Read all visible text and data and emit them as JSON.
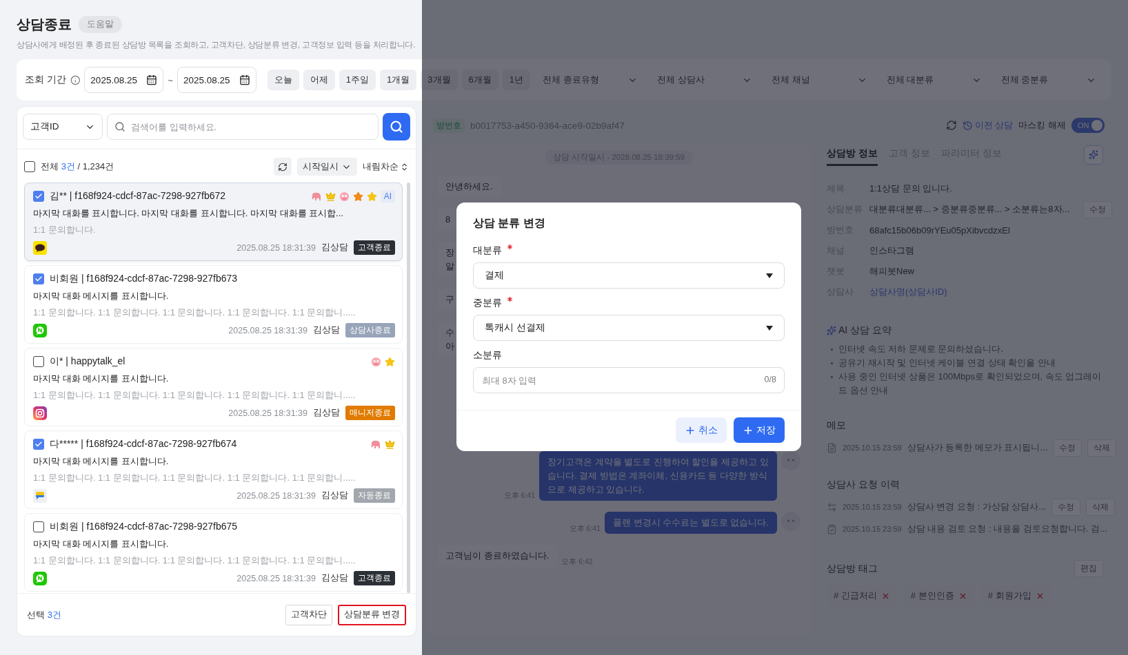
{
  "page": {
    "title": "상담종료",
    "help": "도움말",
    "description": "상담사에게 배정된 후 종료된 상담방 목록을 조회하고, 고객차단, 상담분류 변경, 고객정보 입력 등을 처리합니다."
  },
  "filters": {
    "period_label": "조회 기간",
    "date_from": "2025.08.25",
    "separator": "~",
    "date_to": "2025.08.25",
    "quick_ranges": [
      "오늘",
      "어제",
      "1주일",
      "1개월",
      "3개월",
      "6개월",
      "1년"
    ],
    "dropdowns": [
      "전체 종료유형",
      "전체 상담사",
      "전체 채널",
      "전체 대분류",
      "전체 중분류"
    ]
  },
  "search": {
    "type": "고객ID",
    "placeholder": "검색어를 입력하세요."
  },
  "list_header": {
    "select_all_checked": false,
    "total_label": "전체",
    "shown_count": "3건",
    "total_count": "/ 1,234건",
    "sort_field": "시작일시",
    "sort_order": "내림차순"
  },
  "items": [
    {
      "checked": true,
      "selected": true,
      "title": "김** | f168f924-cdcf-87ac-7298-927fb672",
      "ai": "AI",
      "message": "마지막 대화를 표시합니다.  마지막 대화를 표시합니다. 마지막 대화를 표시합...",
      "summary": "1:1 문의합니다.",
      "time": "2025.08.25 18:31:39",
      "agent": "김상담",
      "status": "고객종료",
      "color": "#2b2f36"
    },
    {
      "checked": true,
      "selected": false,
      "title": "비회원 | f168f924-cdcf-87ac-7298-927fb673",
      "message": "마지막 대화 메시지를 표시합니다.",
      "summary": "1:1 문의합니다. 1:1 문의합니다. 1:1 문의합니다. 1:1 문의합니다. 1:1 문의합니.....",
      "time": "2025.08.25 18:31:39",
      "agent": "김상담",
      "status": "상담사종료",
      "color": "#98a4b8"
    },
    {
      "checked": false,
      "selected": false,
      "title": "이* | happytalk_el",
      "message": "마지막 대화 메시지를 표시합니다.",
      "summary": "1:1 문의합니다. 1:1 문의합니다. 1:1 문의합니다. 1:1 문의합니다. 1:1 문의합니.....",
      "time": "2025.08.25 18:31:39",
      "agent": "김상담",
      "status": "매니저종료",
      "color": "#e07b00"
    },
    {
      "checked": true,
      "selected": false,
      "title": "다***** | f168f924-cdcf-87ac-7298-927fb674",
      "message": "마지막 대화 메시지를 표시합니다.",
      "summary": "1:1 문의합니다. 1:1 문의합니다. 1:1 문의합니다. 1:1 문의합니다. 1:1 문의합니.....",
      "time": "2025.08.25 18:31:39",
      "agent": "김상담",
      "status": "자동종료",
      "color": "#a2a6ad"
    },
    {
      "checked": false,
      "selected": false,
      "title": "비회원 | f168f924-cdcf-87ac-7298-927fb675",
      "message": "마지막 대화 메시지를 표시합니다.",
      "summary": "1:1 문의합니다. 1:1 문의합니다. 1:1 문의합니다. 1:1 문의합니다. 1:1 문의합니.....",
      "time": "2025.08.25 18:31:39",
      "agent": "김상담",
      "status": "고객종료",
      "color": "#2b2f36"
    }
  ],
  "footer": {
    "selected_label": "선택",
    "selected_count": "3건",
    "buttons": [
      {
        "label": "고객차단",
        "highlighted": false
      },
      {
        "label": "상담분류 변경",
        "highlighted": true
      }
    ]
  },
  "room": {
    "id_label": "방번호",
    "id": "b0017753-a450-9364-ace9-02b9af47",
    "history": "이전 상담",
    "masking_label": "마스킹 해제",
    "masking_on": true,
    "masking_text": "ON"
  },
  "chat": {
    "started": "상담 시작일시 - 2028.08.25 18:39:59",
    "messages": [
      {
        "kind": "customer",
        "lines": [
          "안녕하세요."
        ]
      },
      {
        "kind": "customer",
        "lines": [
          "8"
        ]
      },
      {
        "kind": "customer",
        "lines": [
          "장",
          "알"
        ]
      },
      {
        "kind": "customer",
        "lines": [
          "구"
        ]
      },
      {
        "kind": "customer",
        "lines": [
          "수",
          "아"
        ]
      },
      {
        "kind": "agent",
        "lines": [
          "장기고객은 계약을 별도로 진행하여 할인을 제공하고 있습니다.  결제 방법은 계좌이체, 신용카드 등 다양한 방식으로 제공하고 있습니다."
        ],
        "time": "오후 6:41"
      },
      {
        "kind": "agent",
        "lines": [
          "플랜 변경시 수수료는 별도로 없습니다."
        ],
        "time": "오후 6:41"
      },
      {
        "kind": "customer",
        "lines": [
          "고객님이 종료하였습니다."
        ],
        "time": "오후 6:42"
      }
    ]
  },
  "info": {
    "tabs": [
      {
        "label": "상담방 정보",
        "selected": true
      },
      {
        "label": "고객 정보",
        "selected": false
      },
      {
        "label": "파라미터 정보",
        "selected": false
      }
    ],
    "rows": [
      {
        "kind": "text",
        "label": "제목",
        "value": "1:1상담 문의 입니다."
      },
      {
        "kind": "text",
        "label": "상담분류",
        "value": "대분류대분류... > 중분류중분류... > 소분류는8자...",
        "action": "수정"
      },
      {
        "kind": "text",
        "label": "방번호",
        "value": "68afc15b06b09rYEu05pXibvcdzxEl"
      },
      {
        "kind": "text",
        "label": "채널",
        "value": "인스타그램"
      },
      {
        "kind": "text",
        "label": "챗봇",
        "value": "해피봇New"
      },
      {
        "kind": "link",
        "label": "상담사",
        "value": "상담사명(상담사ID)"
      }
    ],
    "ai_summary": {
      "title": "AI 상담 요약",
      "bullets": [
        "인터넷 속도 저하 문제로 문의하셨습니다.",
        "공유기 재시작 및 인터넷 케이블 연결 상태 확인을 안내",
        "사용 중인 인터넷 상품은 100Mbps로 확인되었으며, 속도 업그레이드 옵션 안내"
      ]
    },
    "memo": {
      "title": "메모",
      "entries": [
        {
          "time": "2025.10.15 23:59",
          "text": "상담사가 등록한 메모가 표시됩니...",
          "actions": [
            "수정",
            "삭제"
          ]
        }
      ]
    },
    "requests": {
      "title": "상담사 요청 이력",
      "entries": [
        {
          "time": "2025.10.15 23:59",
          "text": "상담사 변경 요청 : 가상담 상담사...",
          "actions": [
            "수정",
            "삭제"
          ]
        },
        {
          "time": "2025.10.15 23:59",
          "text": "상담 내용 검토 요청 : 내용을 검토요청합니다. 검..."
        }
      ]
    },
    "tags": {
      "title": "상담방 태그",
      "edit": "편집",
      "items": [
        "# 긴급처리",
        "# 본인인증",
        "# 회원가입"
      ]
    }
  },
  "modal": {
    "title": "상담 분류 변경",
    "fields": [
      {
        "kind": "select",
        "label": "대분류",
        "required": true,
        "value": "결제"
      },
      {
        "kind": "select",
        "label": "중분류",
        "required": true,
        "value": "톡캐시 선결제"
      },
      {
        "kind": "input",
        "label": "소분류",
        "required": false,
        "placeholder": "최대 8자 입력",
        "counter": "0/8"
      }
    ],
    "buttons": [
      {
        "kind": "secondary",
        "label": "취소"
      },
      {
        "kind": "primary",
        "label": "저장"
      }
    ]
  }
}
